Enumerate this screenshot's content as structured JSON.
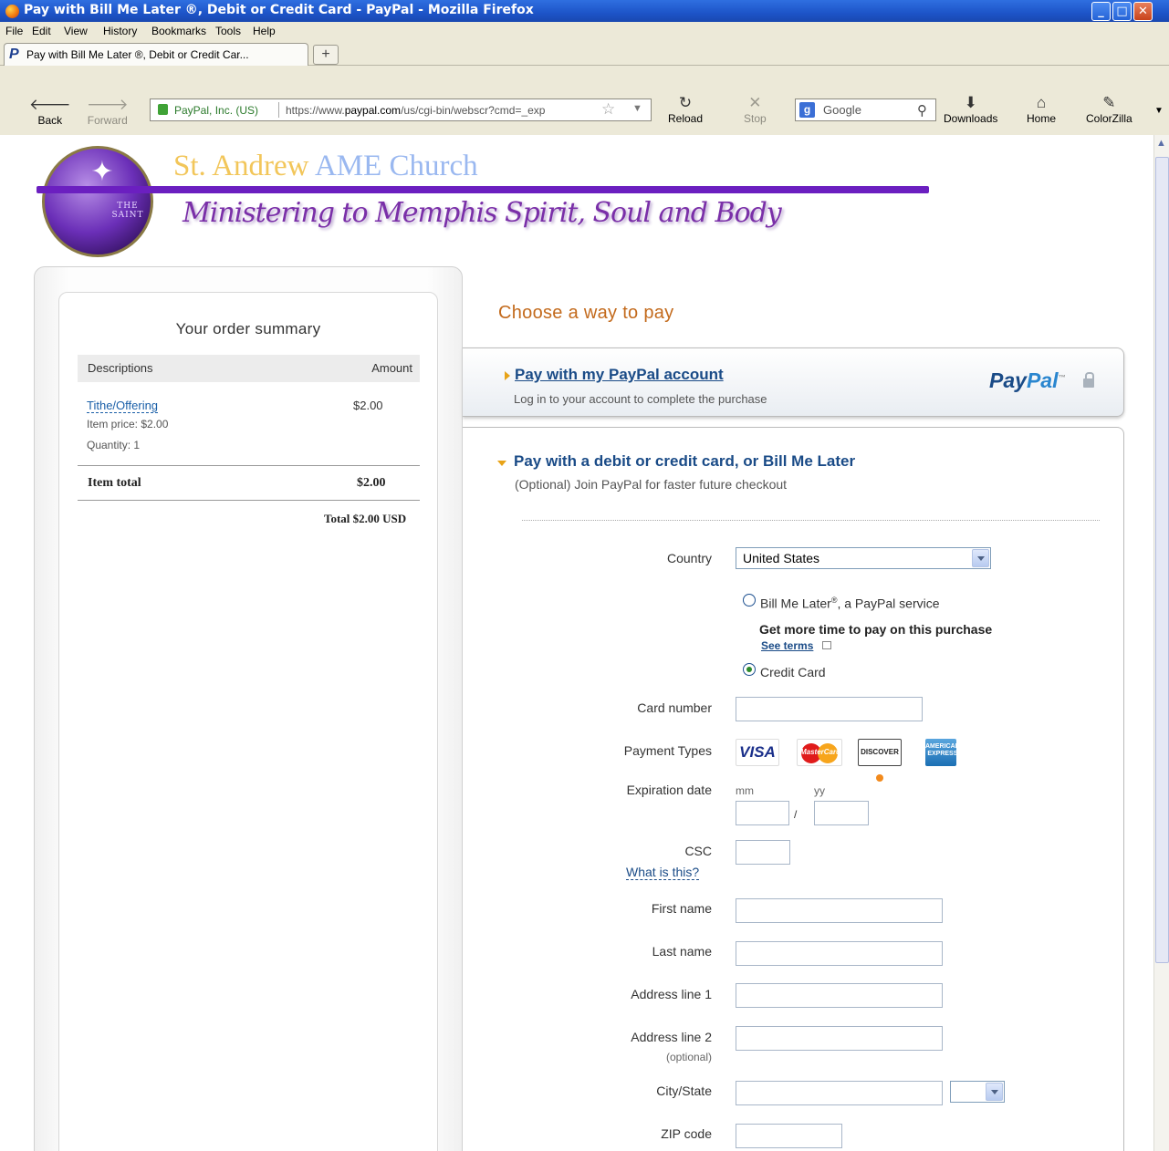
{
  "window": {
    "title": "Pay with Bill Me Later ®, Debit or Credit Card - PayPal - Mozilla Firefox"
  },
  "menu": [
    "File",
    "Edit",
    "View",
    "History",
    "Bookmarks",
    "Tools",
    "Help"
  ],
  "tab": {
    "label": "Pay with Bill Me Later ®, Debit or Credit Car..."
  },
  "nav": {
    "back": "Back",
    "forward": "Forward",
    "reload": "Reload",
    "stop": "Stop",
    "downloads": "Downloads",
    "home": "Home",
    "colorzilla": "ColorZilla",
    "site_identity": "PayPal, Inc. (US)",
    "url_prefix": "https://www.",
    "url_domain": "paypal.com",
    "url_rest": "/us/cgi-bin/webscr?cmd=_exp",
    "search_engine": "Google"
  },
  "header": {
    "church_name_1": "St. Andrew",
    "church_name_2": "AME Church",
    "tagline": "Ministering to Memphis Spirit, Soul and Body",
    "logo_text": "THE SAINT"
  },
  "summary": {
    "title": "Your order summary",
    "col_desc": "Descriptions",
    "col_amount": "Amount",
    "item_name": "Tithe/Offering",
    "item_amount": "$2.00",
    "item_price": "Item price: $2.00",
    "quantity": "Quantity: 1",
    "item_total_label": "Item total",
    "item_total_value": "$2.00",
    "grand_total": "Total $2.00 USD"
  },
  "payment": {
    "heading": "Choose a way to pay",
    "paypal_link": "Pay with my PayPal account",
    "paypal_sub": "Log in to your account to complete the purchase",
    "paypal_logo_1": "Pay",
    "paypal_logo_2": "Pal",
    "paypal_tm": "™",
    "card_title": "Pay with a debit or credit card, or Bill Me Later",
    "card_sub": "(Optional) Join PayPal for faster future checkout"
  },
  "form": {
    "country_label": "Country",
    "country_value": "United States",
    "bml_option": "Bill Me Later",
    "bml_reg": "®",
    "bml_suffix": ", a PayPal service",
    "bml_note": "Get more time to pay on this purchase",
    "see_terms": "See terms",
    "credit_option": "Credit Card",
    "card_number_label": "Card number",
    "payment_types_label": "Payment Types",
    "card_brands": [
      "VISA",
      "MasterCard",
      "DISCOVER",
      "AMERICAN EXPRESS"
    ],
    "expiration_label": "Expiration date",
    "mm": "mm",
    "yy": "yy",
    "slash": "/",
    "csc_label": "CSC",
    "csc_help": "What is this?",
    "first_name_label": "First name",
    "last_name_label": "Last name",
    "address1_label": "Address line 1",
    "address2_label": "Address line 2",
    "optional": "(optional)",
    "city_state_label": "City/State",
    "zip_label": "ZIP code"
  }
}
